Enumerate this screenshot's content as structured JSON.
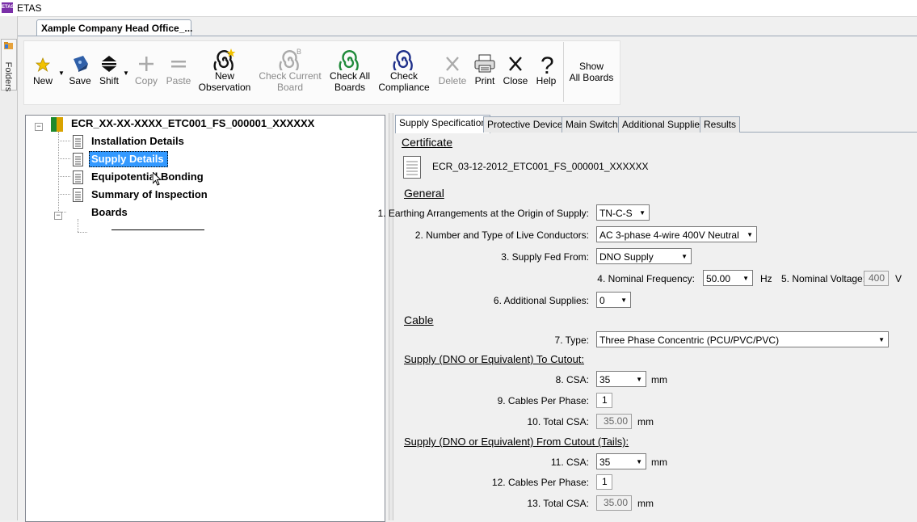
{
  "window": {
    "title": "ETAS",
    "app_icon_text": "ETAS"
  },
  "sidebar": {
    "folders_label": "Folders"
  },
  "doc_tab": {
    "label": "Xample Company Head Office_..."
  },
  "toolbar": {
    "new": "New",
    "save": "Save",
    "shift": "Shift",
    "copy": "Copy",
    "paste": "Paste",
    "new_observation": [
      "New",
      "Observation"
    ],
    "check_current_board": [
      "Check Current",
      "Board"
    ],
    "check_all_boards": [
      "Check All",
      "Boards"
    ],
    "check_compliance": [
      "Check",
      "Compliance"
    ],
    "delete": "Delete",
    "print": "Print",
    "close": "Close",
    "help": "Help",
    "show_all_boards": [
      "Show",
      "All Boards"
    ],
    "check_current_badge": "B"
  },
  "tree": {
    "root": "ECR_XX-XX-XXXX_ETC001_FS_000001_XXXXXX",
    "items": [
      "Installation Details",
      "Supply Details",
      "Equipotential Bonding",
      "Summary of Inspection",
      "Boards"
    ],
    "selected": "Supply Details"
  },
  "tabs": [
    "Supply Specification",
    "Protective Device",
    "Main Switch",
    "Additional Supplies",
    "Results"
  ],
  "certificate": {
    "heading": "Certificate",
    "name": "ECR_03-12-2012_ETC001_FS_000001_XXXXXX"
  },
  "general": {
    "heading": "General",
    "earthing_label": "1. Earthing Arrangements at the Origin of Supply:",
    "earthing_value": "TN-C-S",
    "conductors_label": "2. Number and Type of Live Conductors:",
    "conductors_value": "AC 3-phase 4-wire 400V Neutral",
    "supply_fed_label": "3. Supply Fed From:",
    "supply_fed_value": "DNO Supply",
    "freq_label": "4. Nominal Frequency:",
    "freq_value": "50.00",
    "freq_unit": "Hz",
    "voltage_label": "5. Nominal Voltage:",
    "voltage_value": "400",
    "voltage_unit": "V",
    "additional_label": "6. Additional Supplies:",
    "additional_value": "0"
  },
  "cable": {
    "heading": "Cable",
    "type_label": "7. Type:",
    "type_value": "Three Phase Concentric (PCU/PVC/PVC)"
  },
  "to_cutout": {
    "heading": "Supply (DNO or Equivalent) To Cutout:",
    "csa_label": "8. CSA:",
    "csa_value": "35",
    "csa_unit": "mm",
    "cables_label": "9. Cables Per Phase:",
    "cables_value": "1",
    "total_label": "10. Total CSA:",
    "total_value": "35.00",
    "total_unit": "mm"
  },
  "from_cutout": {
    "heading": "Supply (DNO or Equivalent) From Cutout (Tails):",
    "csa_label": "11. CSA:",
    "csa_value": "35",
    "csa_unit": "mm",
    "cables_label": "12. Cables Per Phase:",
    "cables_value": "1",
    "total_label": "13. Total CSA:",
    "total_value": "35.00",
    "total_unit": "mm"
  }
}
